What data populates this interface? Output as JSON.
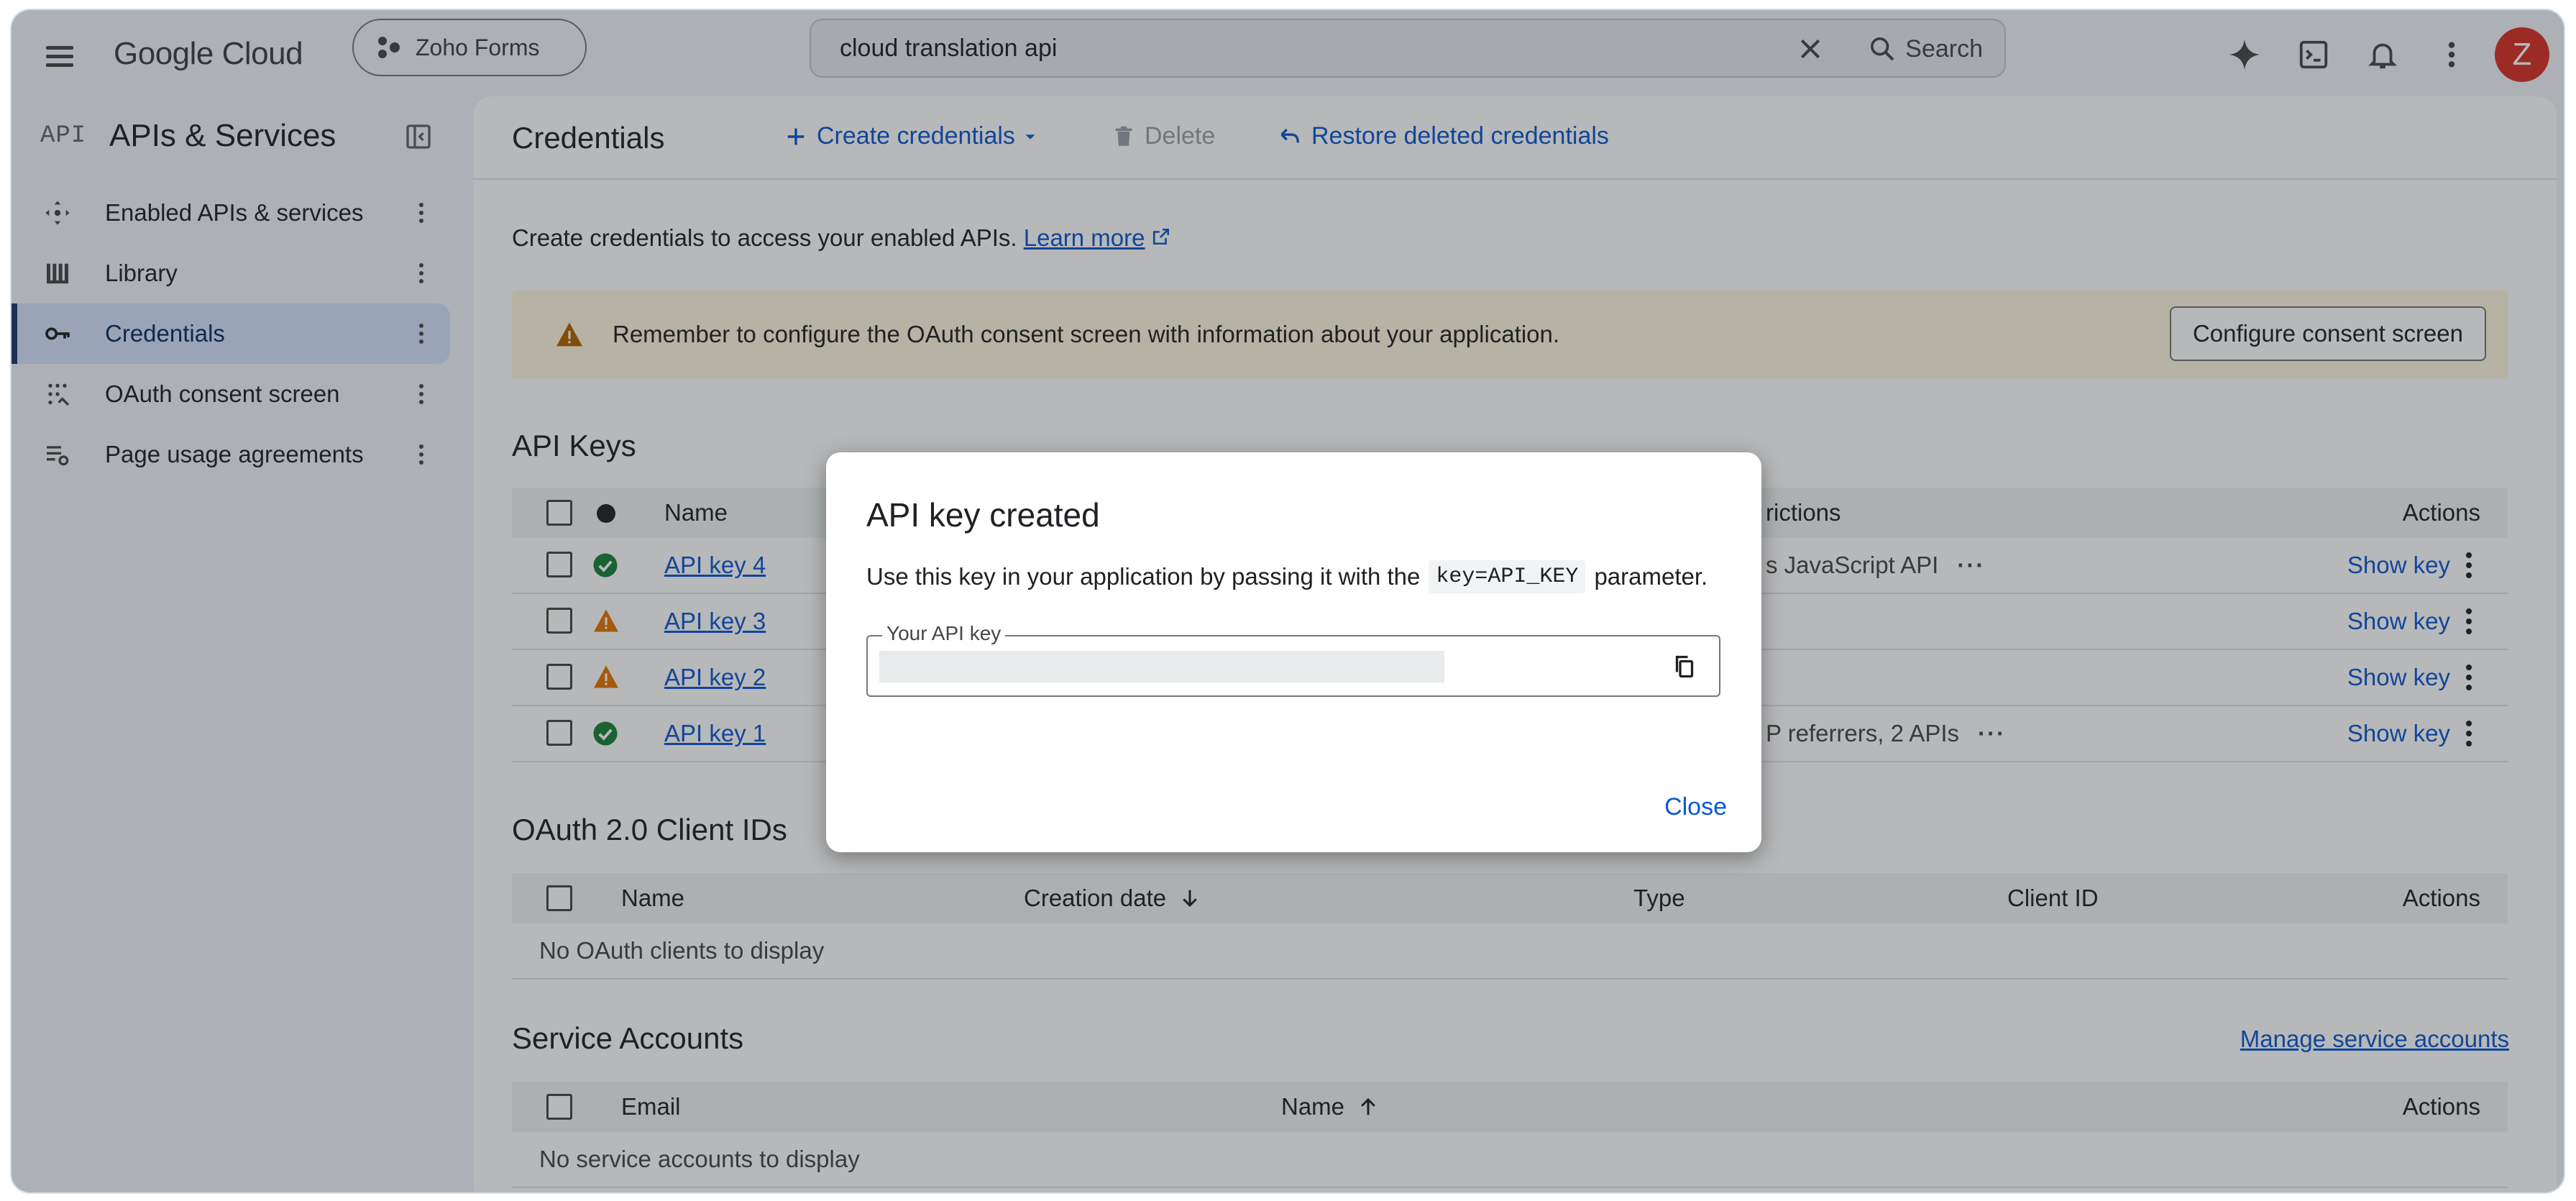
{
  "topbar": {
    "logo": "Google Cloud",
    "project": "Zoho Forms",
    "search_value": "cloud translation api",
    "search_button": "Search",
    "avatar_letter": "Z"
  },
  "sidebar": {
    "glyph": "API",
    "title": "APIs & Services",
    "items": [
      {
        "label": "Enabled APIs & services",
        "icon": "hub-icon"
      },
      {
        "label": "Library",
        "icon": "library-icon"
      },
      {
        "label": "Credentials",
        "icon": "key-icon",
        "active": true
      },
      {
        "label": "OAuth consent screen",
        "icon": "consent-icon"
      },
      {
        "label": "Page usage agreements",
        "icon": "settings-list-icon"
      }
    ]
  },
  "main": {
    "title": "Credentials",
    "create_credentials": "Create credentials",
    "delete": "Delete",
    "restore": "Restore deleted credentials",
    "intro_text": "Create credentials to access your enabled APIs.",
    "learn_more": "Learn more",
    "banner_text": "Remember to configure the OAuth consent screen with information about your application.",
    "banner_button": "Configure consent screen",
    "api_keys": {
      "title": "API Keys",
      "headers": {
        "name": "Name",
        "restrictions": "rictions",
        "actions": "Actions"
      },
      "rows": [
        {
          "name": "API key 4",
          "status": "ok",
          "restriction": "s JavaScript API",
          "has_more": true,
          "action": "Show key"
        },
        {
          "name": "API key 3",
          "status": "warning",
          "restriction": "",
          "has_more": false,
          "action": "Show key"
        },
        {
          "name": "API key 2",
          "status": "warning",
          "restriction": "",
          "has_more": false,
          "action": "Show key"
        },
        {
          "name": "API key 1",
          "status": "ok",
          "restriction": "P referrers, 2 APIs",
          "has_more": true,
          "action": "Show key"
        }
      ],
      "more_dots": "···"
    },
    "oauth": {
      "title": "OAuth 2.0 Client IDs",
      "headers": {
        "name": "Name",
        "creation_date": "Creation date",
        "type": "Type",
        "client_id": "Client ID",
        "actions": "Actions"
      },
      "empty": "No OAuth clients to display"
    },
    "service_accounts": {
      "title": "Service Accounts",
      "manage": "Manage service accounts",
      "headers": {
        "email": "Email",
        "name": "Name",
        "actions": "Actions"
      },
      "empty": "No service accounts to display"
    }
  },
  "dialog": {
    "title": "API key created",
    "body_before": "Use this key in your application by passing it with the",
    "code": "key=API_KEY",
    "body_after": "parameter.",
    "field_label": "Your API key",
    "field_value": "",
    "close": "Close"
  },
  "colors": {
    "accent": "#0b57d0",
    "ok": "#188038",
    "warning": "#e37400",
    "active_nav": "#d3e3fd",
    "banner": "#fef7e0",
    "avatar": "#d93025"
  }
}
